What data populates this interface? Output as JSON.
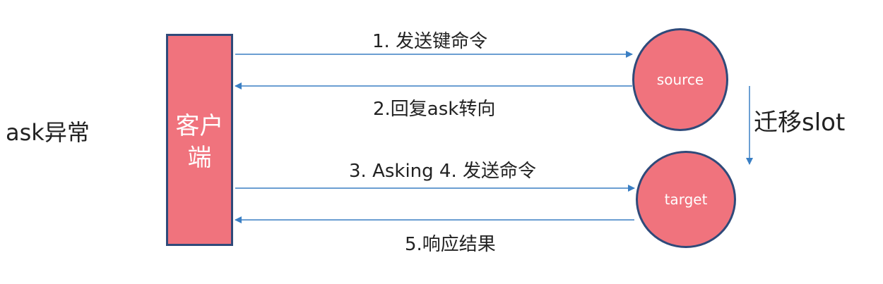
{
  "title": "ask异常",
  "client": {
    "label": "客户端"
  },
  "nodes": {
    "source": "source",
    "target": "target"
  },
  "messages": {
    "m1": "1. 发送键命令",
    "m2": "2.回复ask转向",
    "m3": "3. Asking 4. 发送命令",
    "m5": "5.响应结果"
  },
  "migrate_label": "迁移slot",
  "colors": {
    "fill": "#f0737d",
    "border": "#2f4a7a",
    "arrow": "#3a7fc4"
  }
}
